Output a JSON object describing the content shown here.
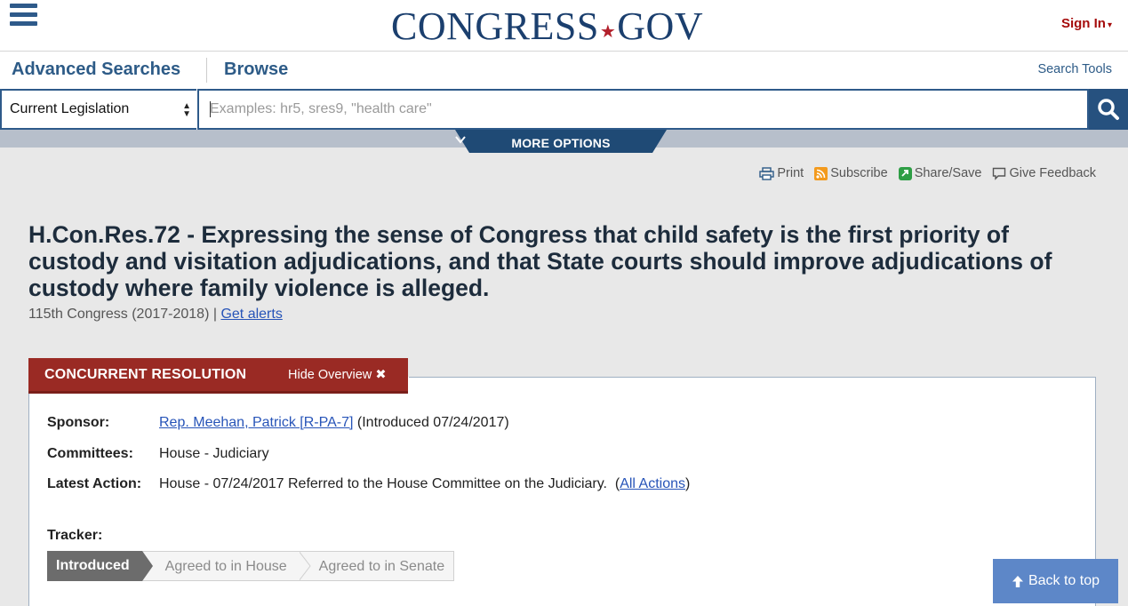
{
  "header": {
    "logo_main": "CONGRESS",
    "logo_dot": "★",
    "logo_suffix": "GOV",
    "signin_label": "Sign In",
    "signin_caret": "▾"
  },
  "nav": {
    "advanced_searches": "Advanced Searches",
    "browse": "Browse",
    "search_tools": "Search Tools"
  },
  "search": {
    "scope_value": "Current Legislation",
    "placeholder": "Examples: hr5, sres9, \"health care\"",
    "more_options": "MORE OPTIONS"
  },
  "tools": {
    "print": "Print",
    "subscribe": "Subscribe",
    "share_save": "Share/Save",
    "give_feedback": "Give Feedback"
  },
  "bill": {
    "title": "H.Con.Res.72 - Expressing the sense of Congress that child safety is the first priority of custody and visitation adjudications, and that State courts should improve adjudications of custody where family violence is alleged.",
    "congress": "115th Congress (2017-2018)",
    "separator": "|",
    "get_alerts": "Get alerts"
  },
  "overview": {
    "type_label": "CONCURRENT RESOLUTION",
    "hide_label": "Hide Overview",
    "hide_icon": "✖",
    "sponsor_label": "Sponsor:",
    "sponsor_name": "Rep. Meehan, Patrick [R-PA-7]",
    "sponsor_intro": "(Introduced 07/24/2017)",
    "committees_label": "Committees:",
    "committees_value": "House - Judiciary",
    "latest_action_label": "Latest Action:",
    "latest_action_value": "House - 07/24/2017 Referred to the House Committee on the Judiciary.",
    "all_actions_open": "(",
    "all_actions": "All Actions",
    "all_actions_close": ")",
    "tracker_label": "Tracker:",
    "tracker_steps": [
      "Introduced",
      "Agreed to in House",
      "Agreed to in Senate"
    ]
  },
  "back_to_top": "Back to top",
  "colors": {
    "navy": "#1b3f6e",
    "red": "#9a2a24",
    "link": "#2754b8"
  }
}
